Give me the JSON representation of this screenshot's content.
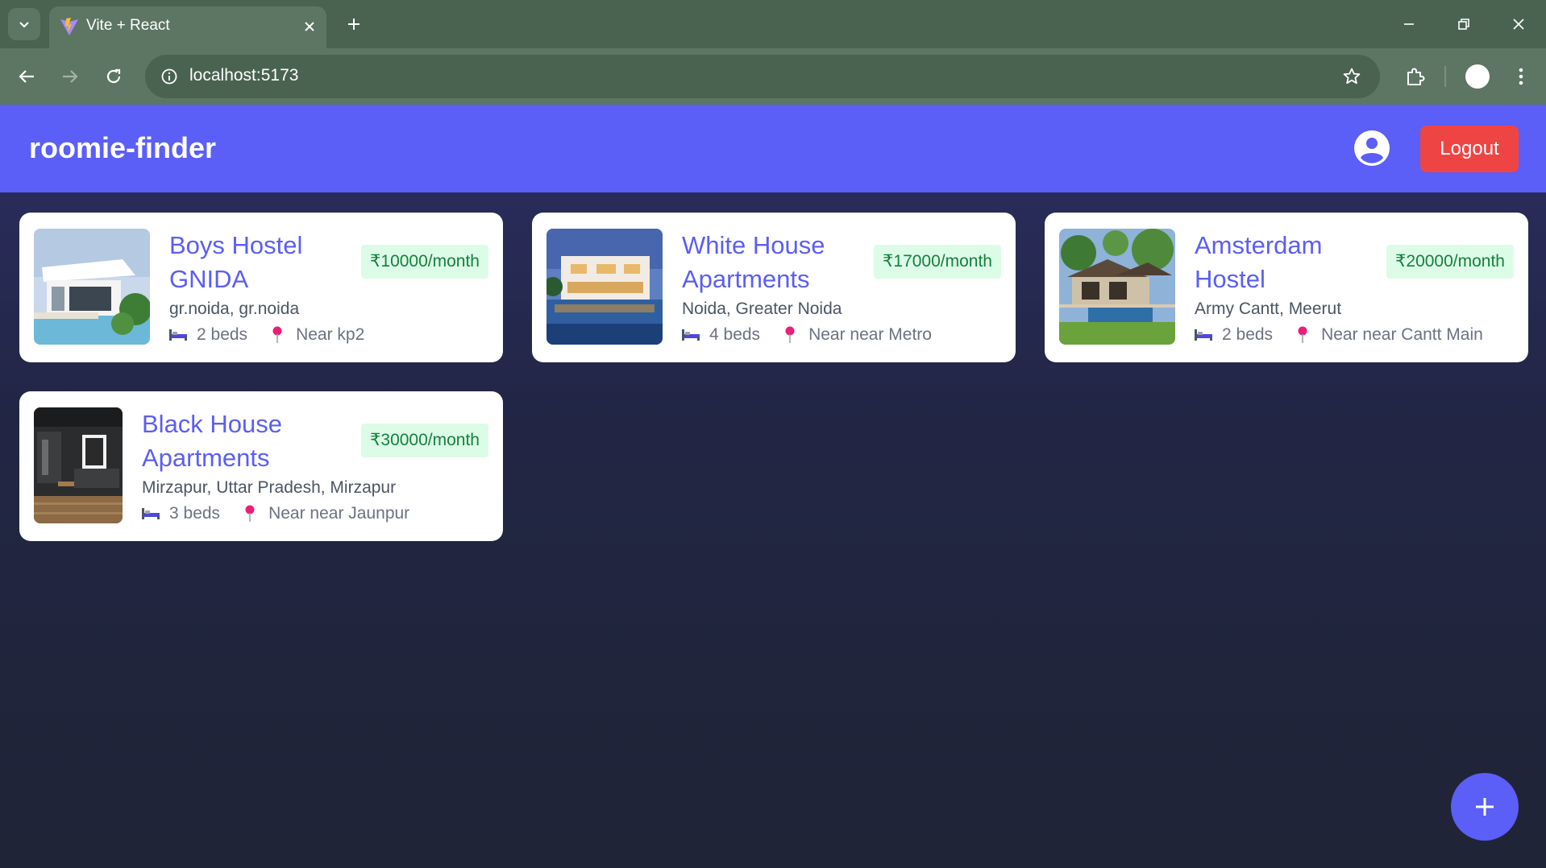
{
  "browser": {
    "tab_title": "Vite + React",
    "url": "localhost:5173"
  },
  "app": {
    "brand": "roomie-finder",
    "logout_label": "Logout",
    "colors": {
      "header": "#5b5ef7",
      "logout": "#ef4444",
      "title": "#5b5ef4",
      "price_bg": "#dcfce7",
      "price_text": "#15803d"
    },
    "listings": [
      {
        "title": "Boys Hostel GNIDA",
        "price": "₹10000/month",
        "address": "gr.noida, gr.noida",
        "beds": "2 beds",
        "near": "Near kp2"
      },
      {
        "title": "White House Apartments",
        "price": "₹17000/month",
        "address": "Noida, Greater Noida",
        "beds": "4 beds",
        "near": "Near near Metro"
      },
      {
        "title": "Amsterdam Hostel",
        "price": "₹20000/month",
        "address": "Army Cantt, Meerut",
        "beds": "2 beds",
        "near": "Near near Cantt Main"
      },
      {
        "title": "Black House Apartments",
        "price": "₹30000/month",
        "address": "Mirzapur, Uttar Pradesh, Mirzapur",
        "beds": "3 beds",
        "near": "Near near Jaunpur"
      }
    ]
  }
}
